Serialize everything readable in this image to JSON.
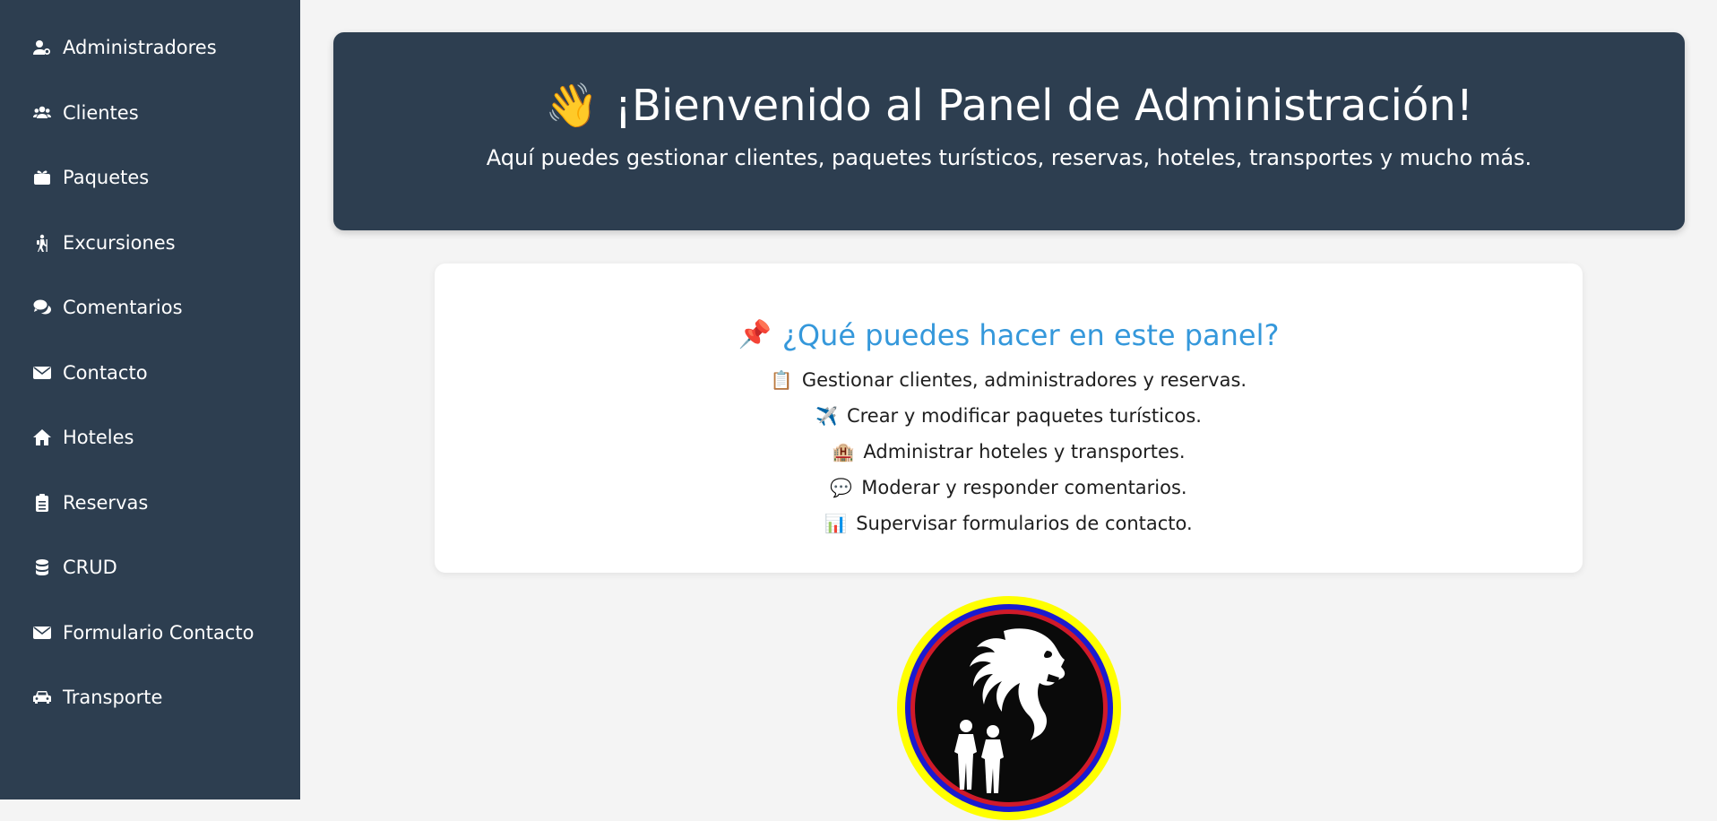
{
  "sidebar": {
    "items": [
      {
        "label": "Administradores",
        "icon": "user-gear-icon"
      },
      {
        "label": "Clientes",
        "icon": "users-icon"
      },
      {
        "label": "Paquetes",
        "icon": "gift-box-icon"
      },
      {
        "label": "Excursiones",
        "icon": "hiker-icon"
      },
      {
        "label": "Comentarios",
        "icon": "comments-icon"
      },
      {
        "label": "Contacto",
        "icon": "envelope-icon"
      },
      {
        "label": "Hoteles",
        "icon": "home-icon"
      },
      {
        "label": "Reservas",
        "icon": "clipboard-list-icon"
      },
      {
        "label": "CRUD",
        "icon": "database-icon"
      },
      {
        "label": "Formulario Contacto",
        "icon": "envelope-icon"
      },
      {
        "label": "Transporte",
        "icon": "car-icon"
      }
    ]
  },
  "hero": {
    "emoji": "👋",
    "title": "¡Bienvenido al Panel de Administración!",
    "subtitle": "Aquí puedes gestionar clientes, paquetes turísticos, reservas, hoteles, transportes y mucho más."
  },
  "card": {
    "emoji": "📌",
    "title": "¿Qué puedes hacer en este panel?",
    "features": [
      {
        "emoji": "📋",
        "text": "Gestionar clientes, administradores y reservas."
      },
      {
        "emoji": "✈️",
        "text": "Crear y modificar paquetes turísticos."
      },
      {
        "emoji": "🏨",
        "text": "Administrar hoteles y transportes."
      },
      {
        "emoji": "💬",
        "text": "Moderar y responder comentarios."
      },
      {
        "emoji": "📊",
        "text": "Supervisar formularios de contacto."
      }
    ]
  },
  "colors": {
    "sidebar_bg": "#2d3e50",
    "accent": "#3598db",
    "page_bg": "#f4f4f4"
  }
}
